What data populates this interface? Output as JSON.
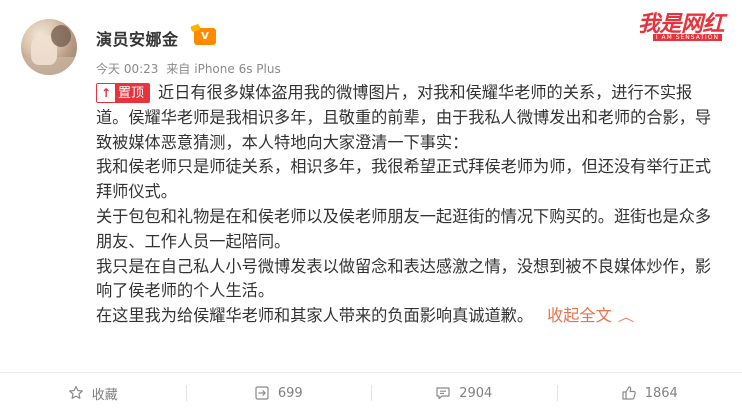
{
  "user": {
    "name": "演员安娜金",
    "badge": "V"
  },
  "post": {
    "time": "今天 00:23",
    "source_prefix": "来自",
    "source": "iPhone 6s Plus",
    "pin_label": "置顶",
    "paragraphs": [
      "近日有很多媒体盗用我的微博图片，对我和侯耀华老师的关系，进行不实报道。侯耀华老师是我相识多年，且敬重的前辈，由于我私人微博发出和老师的合影，导致被媒体恶意猜测，本人特地向大家澄清一下事实：",
      "我和侯老师只是师徒关系，相识多年，我很希望正式拜侯老师为师，但还没有举行正式拜师仪式。",
      "关于包包和礼物是在和侯老师以及侯老师朋友一起逛街的情况下购买的。逛街也是众多朋友、工作人员一起陪同。",
      "我只是在自己私人小号微博发表以做留念和表达感激之情，没想到被不良媒体炒作，影响了侯老师的个人生活。",
      "在这里我为给侯耀华老师和其家人带来的负面影响真诚道歉。"
    ],
    "collapse_label": "收起全文",
    "collapse_icon": "chevron-up-icon"
  },
  "watermark": {
    "text": "我是网红",
    "subtext": "I AM SENSATION"
  },
  "actions": {
    "favorite_label": "收藏",
    "repost_count": "699",
    "comment_count": "2904",
    "like_count": "1864"
  },
  "colors": {
    "accent": "#eb7350",
    "pin": "#e8323c",
    "muted": "#808080"
  }
}
